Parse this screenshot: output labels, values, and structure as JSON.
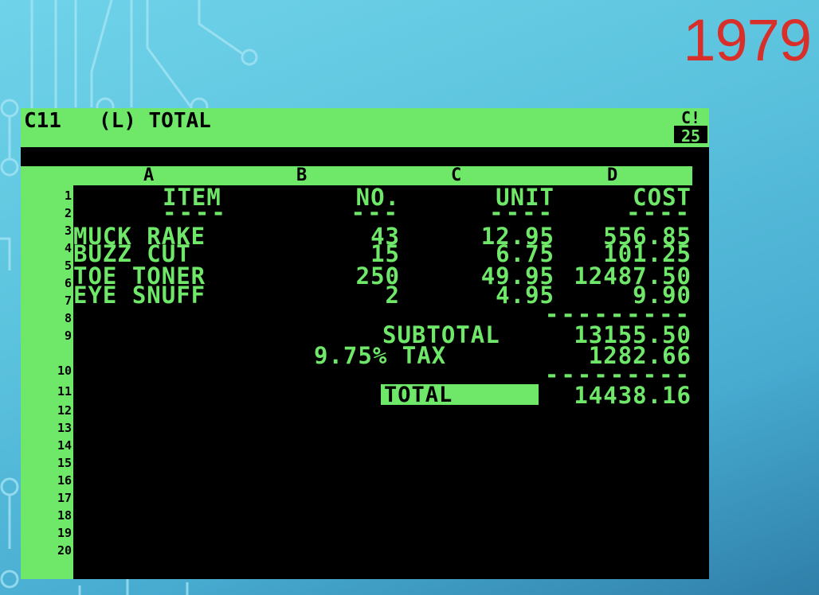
{
  "slide": {
    "year": "1979"
  },
  "visicalc": {
    "status_line": "C11   (L) TOTAL",
    "status_right_top": "C!",
    "status_right_bottom": "25",
    "columns": [
      "A",
      "B",
      "C",
      "D"
    ],
    "row_numbers": [
      "1",
      "2",
      "3",
      "4",
      "5",
      "6",
      "7",
      "8",
      "9",
      "10",
      "11",
      "12",
      "13",
      "14",
      "15",
      "16",
      "17",
      "18",
      "19",
      "20"
    ],
    "headers": {
      "item": "ITEM",
      "no": "NO.",
      "unit": "UNIT",
      "cost": "COST"
    },
    "underline": {
      "item": "----",
      "no": "---",
      "unit": "----",
      "cost": "----"
    },
    "rows": [
      {
        "item": "MUCK RAKE",
        "no": "43",
        "unit": "12.95",
        "cost": "556.85"
      },
      {
        "item": "BUZZ CUT",
        "no": "15",
        "unit": "6.75",
        "cost": "101.25"
      },
      {
        "item": "TOE TONER",
        "no": "250",
        "unit": "49.95",
        "cost": "12487.50"
      },
      {
        "item": "EYE SNUFF",
        "no": "2",
        "unit": "4.95",
        "cost": "9.90"
      }
    ],
    "separator_line": "---------",
    "subtotal_label": "SUBTOTAL",
    "subtotal_value": "13155.50",
    "tax_label": "9.75% TAX",
    "tax_value": "1282.66",
    "total_label": "TOTAL",
    "total_value": "14438.16"
  },
  "colors": {
    "screen_green": "#6fe86a",
    "screen_black": "#000000",
    "year_red": "#d82f2a",
    "background": "#5cc3de"
  }
}
